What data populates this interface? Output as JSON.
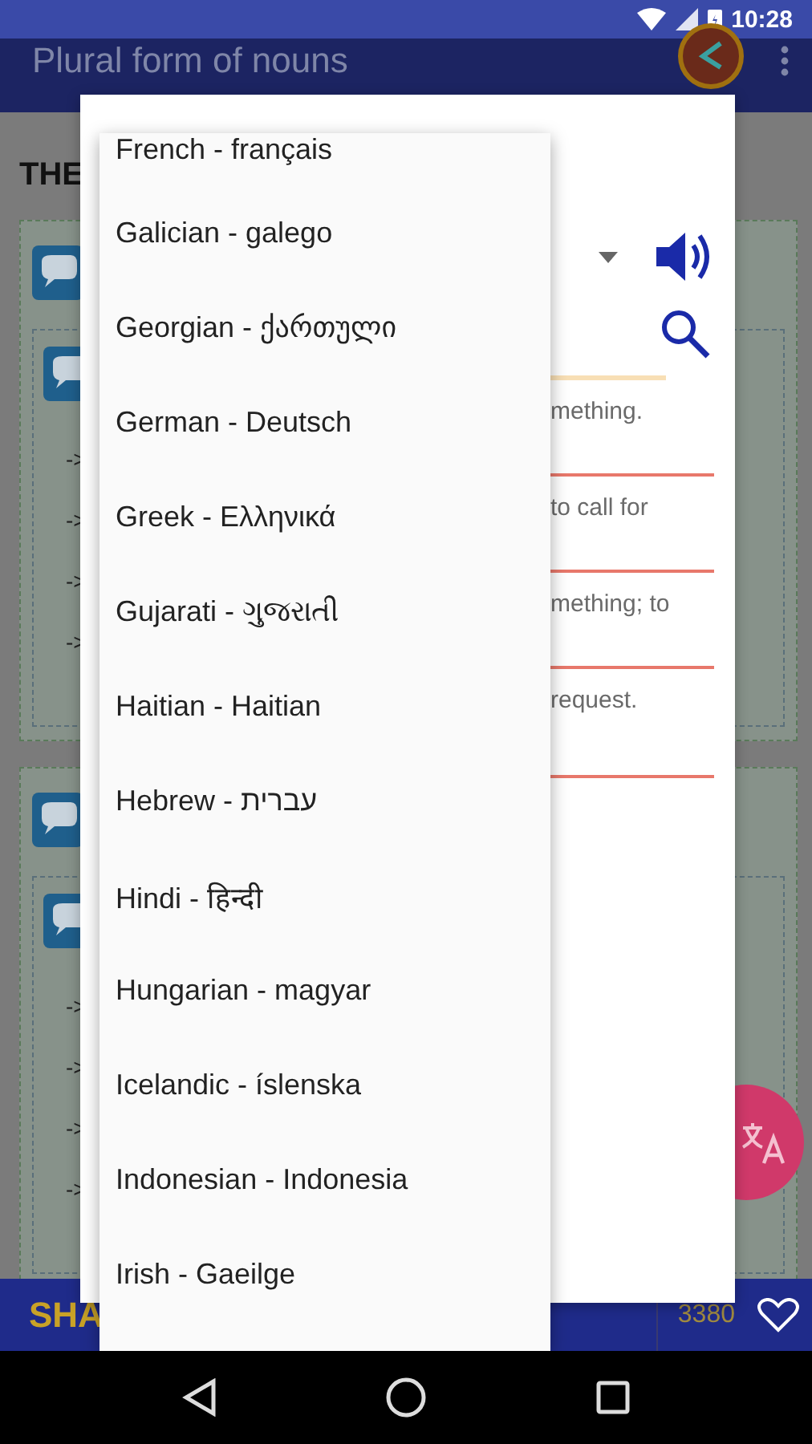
{
  "status_bar": {
    "time": "10:28"
  },
  "app_bar": {
    "title": "Plural form of nouns"
  },
  "content": {
    "heading": "THE",
    "cards": [
      {
        "arrows": [
          "->",
          "->",
          "->",
          "->"
        ]
      },
      {
        "arrows": [
          "->",
          "->",
          "->",
          "->"
        ]
      }
    ]
  },
  "dialog": {
    "definitions": [
      "mething.",
      "to call for",
      "mething; to",
      "request."
    ]
  },
  "language_list": {
    "items": [
      {
        "label": "French - français",
        "selected": false
      },
      {
        "label": "Galician - galego",
        "selected": false
      },
      {
        "label": "Georgian - ქართული",
        "selected": false
      },
      {
        "label": "German - Deutsch",
        "selected": false
      },
      {
        "label": "Greek - Ελληνικά",
        "selected": false
      },
      {
        "label": "Gujarati - ગુજરાતી",
        "selected": false
      },
      {
        "label": "Haitian - Haitian",
        "selected": false
      },
      {
        "label": "Hebrew - עברית",
        "selected": false
      },
      {
        "label": "Hindi - हिन्दी",
        "selected": false
      },
      {
        "label": "Hungarian - magyar",
        "selected": false
      },
      {
        "label": "Icelandic - íslenska",
        "selected": false
      },
      {
        "label": "Indonesian - Indonesia",
        "selected": false
      },
      {
        "label": "Irish - Gaeilge",
        "selected": false
      }
    ]
  },
  "bottom_bar": {
    "label": "SHA",
    "count": "3380"
  }
}
